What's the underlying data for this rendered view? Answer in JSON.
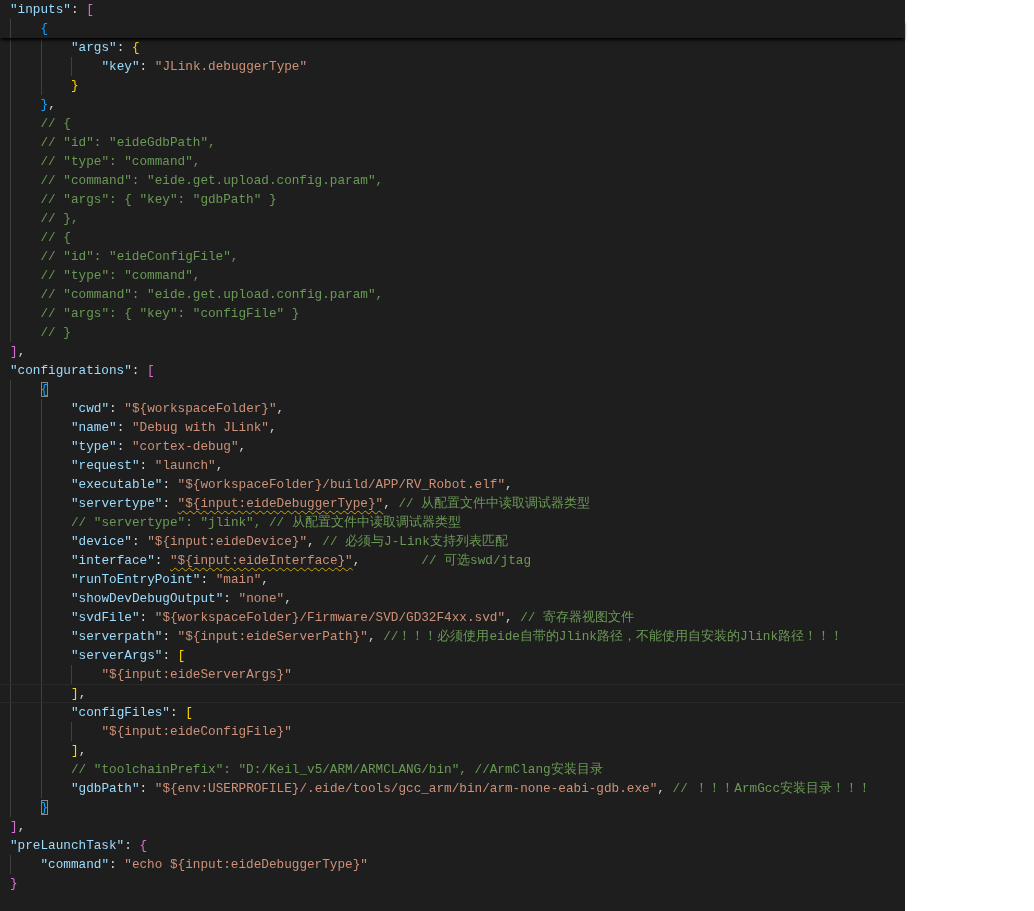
{
  "editor": {
    "lines": [
      {
        "tokens": [
          {
            "kind": "key",
            "text": "\"inputs\""
          },
          {
            "kind": "punct",
            "text": ": "
          },
          {
            "kind": "bracket",
            "text": "[",
            "color": "#da70d6"
          }
        ],
        "children": [
          {
            "sticky": true,
            "tokens": [
              {
                "kind": "bracket",
                "text": "{",
                "color": "#179fff"
              }
            ],
            "children": [
              {
                "tokens": [
                  {
                    "kind": "key",
                    "text": "\"args\""
                  },
                  {
                    "kind": "punct",
                    "text": ": "
                  },
                  {
                    "kind": "bracket",
                    "text": "{",
                    "color": "#ffd700"
                  }
                ],
                "children": [
                  {
                    "tokens": [
                      {
                        "kind": "key",
                        "text": "\"key\""
                      },
                      {
                        "kind": "punct",
                        "text": ": "
                      },
                      {
                        "kind": "string",
                        "text": "\"JLink.debuggerType\""
                      }
                    ]
                  }
                ]
              },
              {
                "tokens": [
                  {
                    "kind": "bracket",
                    "text": "}",
                    "color": "#ffd700"
                  }
                ]
              }
            ]
          },
          {
            "tokens": [
              {
                "kind": "bracket",
                "text": "}",
                "color": "#179fff"
              },
              {
                "kind": "punct",
                "text": ","
              }
            ]
          },
          {
            "tokens": [
              {
                "kind": "comment",
                "text": "// {"
              }
            ]
          },
          {
            "tokens": [
              {
                "kind": "comment",
                "text": "// \"id\": \"eideGdbPath\","
              }
            ]
          },
          {
            "tokens": [
              {
                "kind": "comment",
                "text": "// \"type\": \"command\","
              }
            ]
          },
          {
            "tokens": [
              {
                "kind": "comment",
                "text": "// \"command\": \"eide.get.upload.config.param\","
              }
            ]
          },
          {
            "tokens": [
              {
                "kind": "comment",
                "text": "// \"args\": { \"key\": \"gdbPath\" }"
              }
            ]
          },
          {
            "tokens": [
              {
                "kind": "comment",
                "text": "// },"
              }
            ]
          },
          {
            "tokens": [
              {
                "kind": "comment",
                "text": "// {"
              }
            ]
          },
          {
            "tokens": [
              {
                "kind": "comment",
                "text": "// \"id\": \"eideConfigFile\","
              }
            ]
          },
          {
            "tokens": [
              {
                "kind": "comment",
                "text": "// \"type\": \"command\","
              }
            ]
          },
          {
            "tokens": [
              {
                "kind": "comment",
                "text": "// \"command\": \"eide.get.upload.config.param\","
              }
            ]
          },
          {
            "tokens": [
              {
                "kind": "comment",
                "text": "// \"args\": { \"key\": \"configFile\" }"
              }
            ]
          },
          {
            "tokens": [
              {
                "kind": "comment",
                "text": "// }"
              }
            ]
          }
        ]
      },
      {
        "tokens": [
          {
            "kind": "bracket",
            "text": "]",
            "color": "#da70d6"
          },
          {
            "kind": "punct",
            "text": ","
          }
        ]
      },
      {
        "tokens": [
          {
            "kind": "key",
            "text": "\"configurations\""
          },
          {
            "kind": "punct",
            "text": ": "
          },
          {
            "kind": "bracket",
            "text": "[",
            "color": "#da70d6"
          }
        ],
        "children": [
          {
            "tokens": [
              {
                "kind": "bracket",
                "text": "{",
                "color": "#179fff",
                "matched": true
              }
            ],
            "children": [
              {
                "tokens": [
                  {
                    "kind": "key",
                    "text": "\"cwd\""
                  },
                  {
                    "kind": "punct",
                    "text": ": "
                  },
                  {
                    "kind": "string",
                    "text": "\"${workspaceFolder}\""
                  },
                  {
                    "kind": "punct",
                    "text": ","
                  }
                ]
              },
              {
                "tokens": [
                  {
                    "kind": "key",
                    "text": "\"name\""
                  },
                  {
                    "kind": "punct",
                    "text": ": "
                  },
                  {
                    "kind": "string",
                    "text": "\"Debug with JLink\""
                  },
                  {
                    "kind": "punct",
                    "text": ","
                  }
                ]
              },
              {
                "tokens": [
                  {
                    "kind": "key",
                    "text": "\"type\""
                  },
                  {
                    "kind": "punct",
                    "text": ": "
                  },
                  {
                    "kind": "string",
                    "text": "\"cortex-debug\""
                  },
                  {
                    "kind": "punct",
                    "text": ","
                  }
                ]
              },
              {
                "tokens": [
                  {
                    "kind": "key",
                    "text": "\"request\""
                  },
                  {
                    "kind": "punct",
                    "text": ": "
                  },
                  {
                    "kind": "string",
                    "text": "\"launch\""
                  },
                  {
                    "kind": "punct",
                    "text": ","
                  }
                ]
              },
              {
                "tokens": [
                  {
                    "kind": "key",
                    "text": "\"executable\""
                  },
                  {
                    "kind": "punct",
                    "text": ": "
                  },
                  {
                    "kind": "string",
                    "text": "\"${workspaceFolder}/build/APP/RV_Robot.elf\""
                  },
                  {
                    "kind": "punct",
                    "text": ","
                  }
                ]
              },
              {
                "tokens": [
                  {
                    "kind": "key",
                    "text": "\"servertype\""
                  },
                  {
                    "kind": "punct",
                    "text": ": "
                  },
                  {
                    "kind": "string",
                    "text": "\"${input:eideDebuggerType}\"",
                    "warning": true
                  },
                  {
                    "kind": "punct",
                    "text": ", "
                  },
                  {
                    "kind": "comment",
                    "text": "// 从配置文件中读取调试器类型"
                  }
                ]
              },
              {
                "tokens": [
                  {
                    "kind": "comment",
                    "text": "// \"servertype\": \"jlink\", // 从配置文件中读取调试器类型"
                  }
                ]
              },
              {
                "tokens": [
                  {
                    "kind": "key",
                    "text": "\"device\""
                  },
                  {
                    "kind": "punct",
                    "text": ": "
                  },
                  {
                    "kind": "string",
                    "text": "\"${input:eideDevice}\""
                  },
                  {
                    "kind": "punct",
                    "text": ", "
                  },
                  {
                    "kind": "comment",
                    "text": "// 必须与J-Link支持列表匹配"
                  }
                ]
              },
              {
                "tokens": [
                  {
                    "kind": "key",
                    "text": "\"interface\""
                  },
                  {
                    "kind": "punct",
                    "text": ": "
                  },
                  {
                    "kind": "string",
                    "text": "\"${input:eideInterface}\"",
                    "warning": true
                  },
                  {
                    "kind": "punct",
                    "text": ",        "
                  },
                  {
                    "kind": "comment",
                    "text": "// 可选swd/jtag"
                  }
                ]
              },
              {
                "tokens": [
                  {
                    "kind": "key",
                    "text": "\"runToEntryPoint\""
                  },
                  {
                    "kind": "punct",
                    "text": ": "
                  },
                  {
                    "kind": "string",
                    "text": "\"main\""
                  },
                  {
                    "kind": "punct",
                    "text": ","
                  }
                ]
              },
              {
                "tokens": [
                  {
                    "kind": "key",
                    "text": "\"showDevDebugOutput\""
                  },
                  {
                    "kind": "punct",
                    "text": ": "
                  },
                  {
                    "kind": "string",
                    "text": "\"none\""
                  },
                  {
                    "kind": "punct",
                    "text": ","
                  }
                ]
              },
              {
                "tokens": [
                  {
                    "kind": "key",
                    "text": "\"svdFile\""
                  },
                  {
                    "kind": "punct",
                    "text": ": "
                  },
                  {
                    "kind": "string",
                    "text": "\"${workspaceFolder}/Firmware/SVD/GD32F4xx.svd\""
                  },
                  {
                    "kind": "punct",
                    "text": ", "
                  },
                  {
                    "kind": "comment",
                    "text": "// 寄存器视图文件"
                  }
                ]
              },
              {
                "tokens": [
                  {
                    "kind": "key",
                    "text": "\"serverpath\""
                  },
                  {
                    "kind": "punct",
                    "text": ": "
                  },
                  {
                    "kind": "string",
                    "text": "\"${input:eideServerPath}\""
                  },
                  {
                    "kind": "punct",
                    "text": ", "
                  },
                  {
                    "kind": "comment",
                    "text": "//！！！必须使用eide自带的Jlink路径，不能使用自安装的Jlink路径！！！"
                  }
                ]
              },
              {
                "tokens": [
                  {
                    "kind": "key",
                    "text": "\"serverArgs\""
                  },
                  {
                    "kind": "punct",
                    "text": ": "
                  },
                  {
                    "kind": "bracket",
                    "text": "[",
                    "color": "#ffd700"
                  }
                ],
                "children": [
                  {
                    "tokens": [
                      {
                        "kind": "string",
                        "text": "\"${input:eideServerArgs}\""
                      }
                    ]
                  }
                ]
              },
              {
                "current": true,
                "tokens": [
                  {
                    "kind": "bracket",
                    "text": "]",
                    "color": "#ffd700"
                  },
                  {
                    "kind": "punct",
                    "text": ","
                  }
                ]
              },
              {
                "tokens": [
                  {
                    "kind": "key",
                    "text": "\"configFiles\""
                  },
                  {
                    "kind": "punct",
                    "text": ": "
                  },
                  {
                    "kind": "bracket",
                    "text": "[",
                    "color": "#ffd700"
                  }
                ],
                "children": [
                  {
                    "tokens": [
                      {
                        "kind": "string",
                        "text": "\"${input:eideConfigFile}\""
                      }
                    ]
                  }
                ]
              },
              {
                "tokens": [
                  {
                    "kind": "bracket",
                    "text": "]",
                    "color": "#ffd700"
                  },
                  {
                    "kind": "punct",
                    "text": ","
                  }
                ]
              },
              {
                "tokens": [
                  {
                    "kind": "comment",
                    "text": "// \"toolchainPrefix\": \"D:/Keil_v5/ARM/ARMCLANG/bin\", //ArmClang安装目录"
                  }
                ]
              },
              {
                "tokens": [
                  {
                    "kind": "key",
                    "text": "\"gdbPath\""
                  },
                  {
                    "kind": "punct",
                    "text": ": "
                  },
                  {
                    "kind": "string",
                    "text": "\"${env:USERPROFILE}/.eide/tools/gcc_arm/bin/arm-none-eabi-gdb.exe\""
                  },
                  {
                    "kind": "punct",
                    "text": ", "
                  },
                  {
                    "kind": "comment",
                    "text": "// ！！！ArmGcc安装目录！！！"
                  }
                ]
              }
            ]
          },
          {
            "tokens": [
              {
                "kind": "bracket",
                "text": "}",
                "color": "#179fff",
                "matched": true
              }
            ]
          }
        ]
      },
      {
        "tokens": [
          {
            "kind": "bracket",
            "text": "]",
            "color": "#da70d6"
          },
          {
            "kind": "punct",
            "text": ","
          }
        ]
      },
      {
        "tokens": [
          {
            "kind": "key",
            "text": "\"preLaunchTask\""
          },
          {
            "kind": "punct",
            "text": ": "
          },
          {
            "kind": "bracket",
            "text": "{",
            "color": "#da70d6"
          }
        ],
        "children": [
          {
            "tokens": [
              {
                "kind": "key",
                "text": "\"command\""
              },
              {
                "kind": "punct",
                "text": ": "
              },
              {
                "kind": "string",
                "text": "\"echo ${input:eideDebuggerType}\""
              }
            ]
          }
        ]
      },
      {
        "tokens": [
          {
            "kind": "bracket",
            "text": "}",
            "color": "#da70d6"
          }
        ]
      }
    ]
  }
}
